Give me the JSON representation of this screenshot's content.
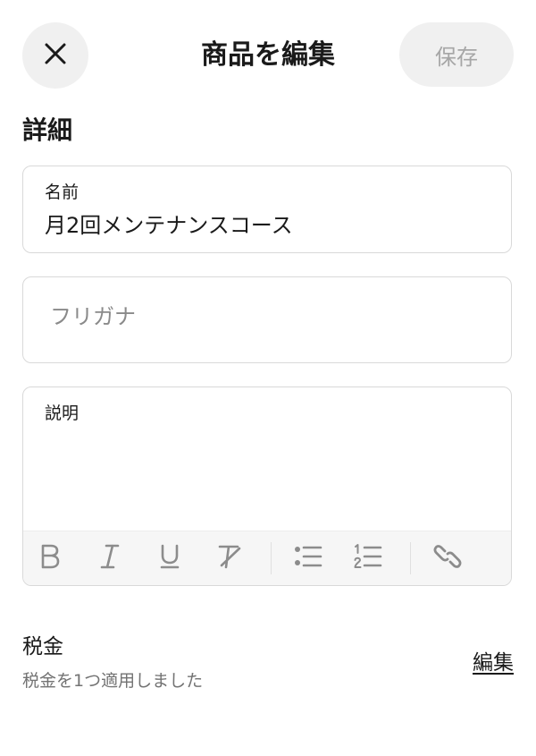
{
  "header": {
    "close_icon": "close-icon",
    "title": "商品を編集",
    "save_label": "保存"
  },
  "details": {
    "section_title": "詳細",
    "name": {
      "label": "名前",
      "value": "月2回メンテナンスコース"
    },
    "furigana": {
      "placeholder": "フリガナ",
      "value": ""
    },
    "description": {
      "label": "説明",
      "value": "",
      "toolbar": [
        {
          "name": "bold",
          "icon": "bold-icon"
        },
        {
          "name": "italic",
          "icon": "italic-icon"
        },
        {
          "name": "underline",
          "icon": "underline-icon"
        },
        {
          "name": "clear-format",
          "icon": "clear-format-icon"
        },
        {
          "name": "bullet-list",
          "icon": "bullet-list-icon"
        },
        {
          "name": "numbered-list",
          "icon": "numbered-list-icon"
        },
        {
          "name": "link",
          "icon": "link-icon"
        }
      ]
    }
  },
  "tax": {
    "title": "税金",
    "summary": "税金を1つ適用しました",
    "edit_label": "編集"
  },
  "colors": {
    "button_bg": "#f0f0f0",
    "disabled_text": "#a6a6a6",
    "border": "#d9d9d9",
    "toolbar_bg": "#f6f6f6",
    "icon_gray": "#8c8c8c",
    "secondary_text": "#737373"
  }
}
